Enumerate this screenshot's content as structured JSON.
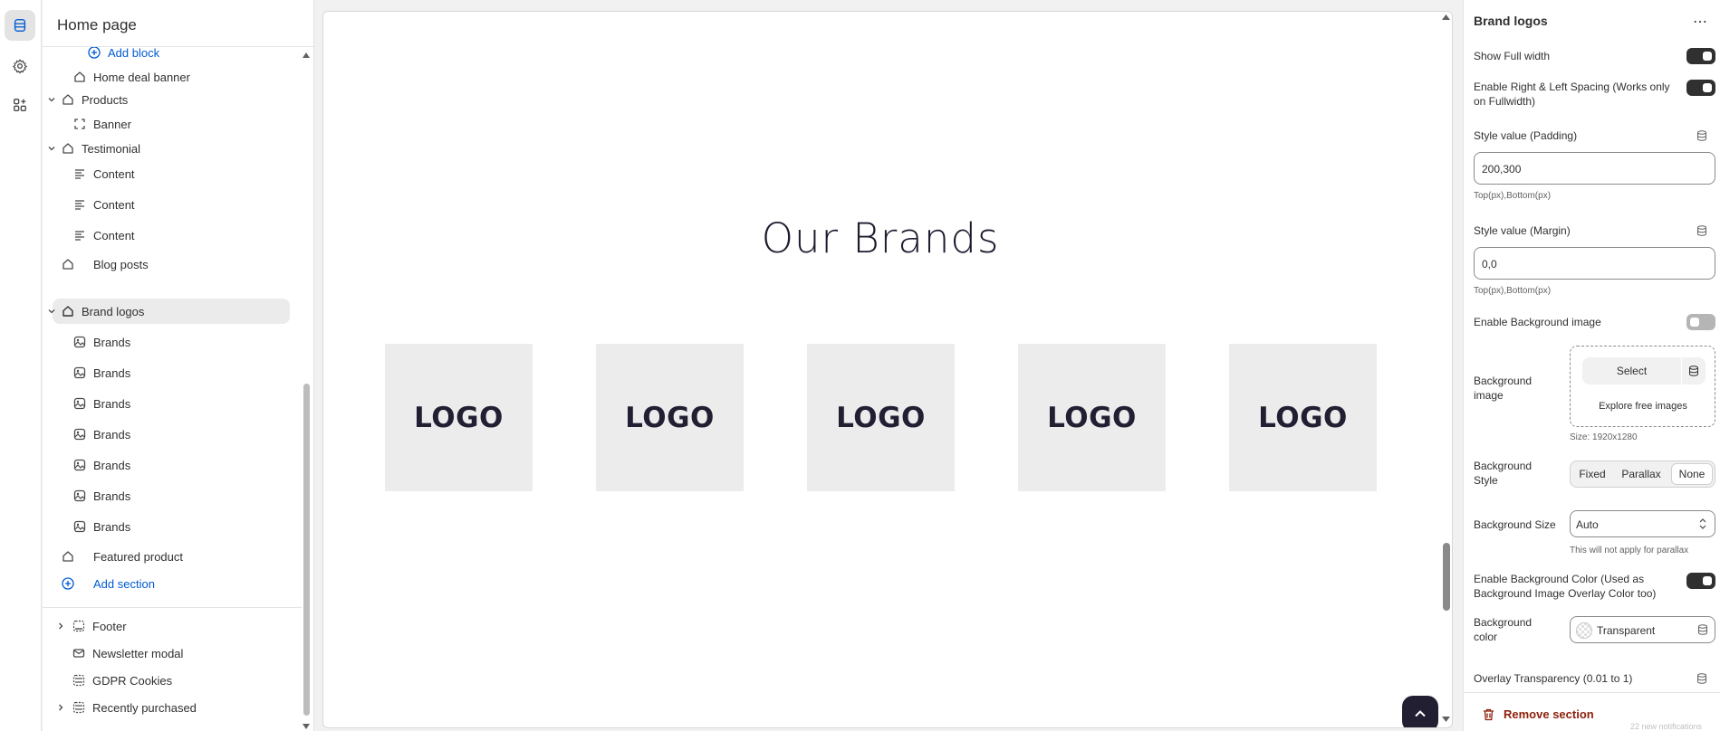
{
  "sidebar": {
    "title": "Home page",
    "items": [
      {
        "label": "Add block",
        "icon": "plus-circle-icon",
        "kind": "link"
      },
      {
        "label": "Home deal banner",
        "icon": "section-icon"
      },
      {
        "label": "Products",
        "icon": "section-icon",
        "expanded": true
      },
      {
        "label": "Banner",
        "icon": "block-frame-icon"
      },
      {
        "label": "Testimonial",
        "icon": "section-icon",
        "expanded": true
      },
      {
        "label": "Content",
        "icon": "text-lines-icon"
      },
      {
        "label": "Content",
        "icon": "text-lines-icon"
      },
      {
        "label": "Content",
        "icon": "text-lines-icon"
      },
      {
        "label": "Blog posts",
        "icon": "section-icon"
      },
      {
        "label": "Brand logos",
        "icon": "section-icon",
        "expanded": true,
        "selected": true
      },
      {
        "label": "Brands",
        "icon": "image-icon"
      },
      {
        "label": "Brands",
        "icon": "image-icon"
      },
      {
        "label": "Brands",
        "icon": "image-icon"
      },
      {
        "label": "Brands",
        "icon": "image-icon"
      },
      {
        "label": "Brands",
        "icon": "image-icon"
      },
      {
        "label": "Brands",
        "icon": "image-icon"
      },
      {
        "label": "Brands",
        "icon": "image-icon"
      },
      {
        "label": "Featured product",
        "icon": "section-icon"
      },
      {
        "label": "Add section",
        "icon": "plus-circle-icon",
        "kind": "link"
      }
    ],
    "footer_items": [
      {
        "label": "Footer",
        "icon": "footer-icon",
        "collapsed": true
      },
      {
        "label": "Newsletter modal",
        "icon": "mail-icon"
      },
      {
        "label": "GDPR Cookies",
        "icon": "cookie-icon"
      },
      {
        "label": "Recently purchased",
        "icon": "list-icon",
        "collapsed": true
      }
    ]
  },
  "preview": {
    "heading": "Our Brands",
    "logos": [
      "LOGO",
      "LOGO",
      "LOGO",
      "LOGO",
      "LOGO"
    ]
  },
  "panel": {
    "title": "Brand logos",
    "more": "⋯",
    "show_full_width": {
      "label": "Show Full width",
      "on": true
    },
    "spacing": {
      "label": "Enable Right & Left Spacing (Works only on Fullwidth)",
      "on": true
    },
    "padding": {
      "label": "Style value (Padding)",
      "value": "200,300",
      "help": "Top(px),Bottom(px)"
    },
    "margin": {
      "label": "Style value (Margin)",
      "value": "0,0",
      "help": "Top(px),Bottom(px)"
    },
    "bg_image_toggle": {
      "label": "Enable Background image",
      "on": false
    },
    "bg_image": {
      "label": "Background image",
      "select": "Select",
      "explore": "Explore free images",
      "size": "Size: 1920x1280"
    },
    "bg_style": {
      "label": "Background Style",
      "options": [
        "Fixed",
        "Parallax",
        "None"
      ],
      "selected": "None"
    },
    "bg_size": {
      "label": "Background Size",
      "value": "Auto",
      "help": "This will not apply for parallax"
    },
    "bg_color_toggle": {
      "label": "Enable Background Color (Used as Background Image Overlay Color too)",
      "on": true
    },
    "bg_color": {
      "label": "Background color",
      "value": "Transparent"
    },
    "overlay": {
      "label": "Overlay Transparency (0.01 to 1)"
    },
    "remove": "Remove section",
    "toast": "22 new notifications"
  },
  "colors": {
    "accent": "#005bd3",
    "danger": "#8e1f0b",
    "dark": "#231f33"
  }
}
